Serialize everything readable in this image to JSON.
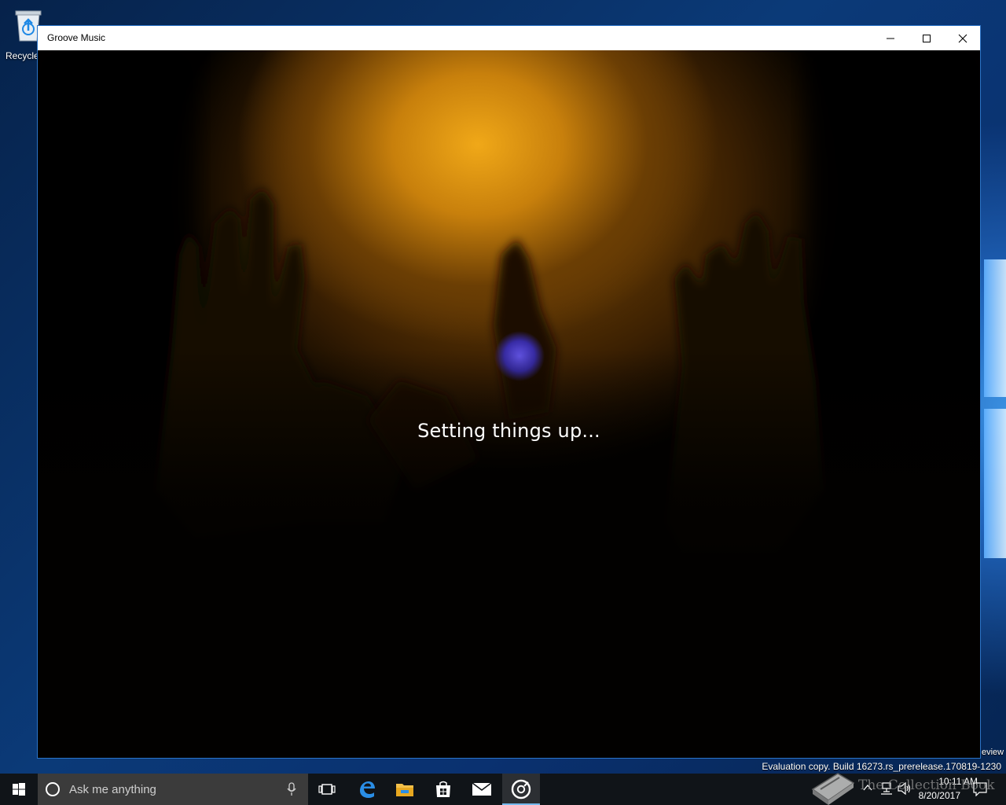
{
  "desktop": {
    "icons": [
      {
        "label": "Recycle",
        "icon": "recycle-bin-icon"
      }
    ],
    "watermark_build": "Evaluation copy. Build 16273.rs_prerelease.170819-1230",
    "watermark_preview": "eview"
  },
  "window": {
    "title": "Groove Music",
    "controls": [
      "minimize-icon",
      "maximize-icon",
      "close-icon"
    ],
    "status_text": "Setting things up...",
    "accent_color": "#1e7ee6"
  },
  "taskbar": {
    "search_placeholder": "Ask me anything",
    "apps": [
      {
        "name": "task-view",
        "icon": "task-view-icon"
      },
      {
        "name": "edge",
        "icon": "edge-icon"
      },
      {
        "name": "file-explorer",
        "icon": "folder-icon"
      },
      {
        "name": "store",
        "icon": "store-icon"
      },
      {
        "name": "mail",
        "icon": "mail-icon"
      },
      {
        "name": "groove-music",
        "icon": "groove-music-icon",
        "active": true
      }
    ],
    "clock_time": "10:11 AM",
    "clock_date": "8/20/2017",
    "overlay_text": "The Collection Book"
  }
}
